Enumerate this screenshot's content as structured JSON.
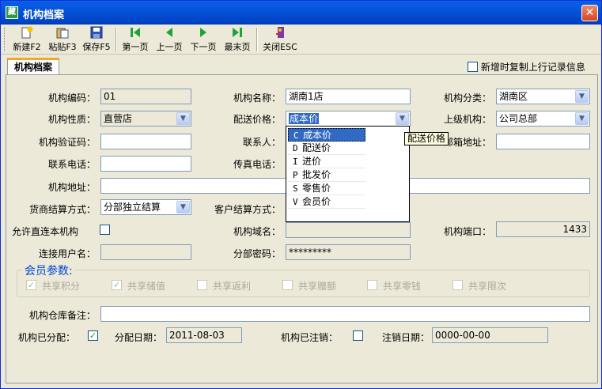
{
  "window": {
    "title": "机构档案",
    "app_icon": "app-logo-icon",
    "close_icon": "close-icon"
  },
  "toolbar": {
    "new": "新建F2",
    "paste": "粘贴F3",
    "save": "保存F5",
    "first": "第一页",
    "prev": "上一页",
    "next": "下一页",
    "last": "最末页",
    "close": "关闭ESC",
    "icons": [
      "new-doc-icon",
      "paste-icon",
      "save-disk-icon",
      "first-page-icon",
      "prev-page-icon",
      "next-page-icon",
      "last-page-icon",
      "exit-door-icon"
    ]
  },
  "tab": {
    "label": "机构档案"
  },
  "copy_prev": {
    "label": "新增时复制上行记录信息",
    "checked": false
  },
  "form": {
    "org_code": {
      "label": "机构编码：",
      "value": "01"
    },
    "org_name": {
      "label": "机构名称：",
      "value": "湖南1店"
    },
    "org_category": {
      "label": "机构分类：",
      "value": "湖南区"
    },
    "org_nature": {
      "label": "机构性质：",
      "value": "直营店"
    },
    "delivery_price": {
      "label": "配送价格：",
      "value": "成本价"
    },
    "parent_org": {
      "label": "上级机构：",
      "value": "公司总部"
    },
    "verify_code": {
      "label": "机构验证码：",
      "value": ""
    },
    "contact": {
      "label": "联系人：",
      "value": ""
    },
    "zip": {
      "label": "邮箱地址：",
      "value": ""
    },
    "phone": {
      "label": "联系电话：",
      "value": ""
    },
    "fax": {
      "label": "传真电话：",
      "value": ""
    },
    "address": {
      "label": "机构地址：",
      "value": ""
    },
    "supplier_settle": {
      "label": "货商结算方式：",
      "value": "分部独立结算"
    },
    "customer_settle": {
      "label": "客户结算方式：",
      "value": ""
    },
    "direct_connect": {
      "label": "允许直连本机构",
      "checked": false
    },
    "domain": {
      "label": "机构域名：",
      "value": ""
    },
    "port": {
      "label": "机构端口：",
      "value": "1433"
    },
    "conn_user": {
      "label": "连接用户名：",
      "value": ""
    },
    "sub_password": {
      "label": "分部密码：",
      "value": "*********"
    },
    "warehouse_note": {
      "label": "机构仓库备注：",
      "value": ""
    },
    "assigned": {
      "label": "机构已分配：",
      "checked": true
    },
    "assign_date": {
      "label": "分配日期：",
      "value": "2011-08-03"
    },
    "cancelled": {
      "label": "机构已注销：",
      "checked": false
    },
    "cancel_date": {
      "label": "注销日期：",
      "value": "0000-00-00"
    }
  },
  "member": {
    "title": "会员参数:",
    "options": [
      {
        "label": "共享积分",
        "checked": true
      },
      {
        "label": "共享储值",
        "checked": true
      },
      {
        "label": "共享返利",
        "checked": false
      },
      {
        "label": "共享赠额",
        "checked": false
      },
      {
        "label": "共享零钱",
        "checked": false
      },
      {
        "label": "共享限次",
        "checked": false
      }
    ]
  },
  "price_dropdown": {
    "items": [
      {
        "code": "C",
        "label": "成本价",
        "selected": true
      },
      {
        "code": "D",
        "label": "配送价",
        "selected": false
      },
      {
        "code": "I",
        "label": "进价",
        "selected": false
      },
      {
        "code": "P",
        "label": "批发价",
        "selected": false
      },
      {
        "code": "S",
        "label": "零售价",
        "selected": false
      },
      {
        "code": "V",
        "label": "会员价",
        "selected": false
      }
    ],
    "tooltip": "配送价格"
  },
  "colors": {
    "titlebar": "#0454d9",
    "accent_tab": "#f5a623",
    "selection": "#316ac5",
    "group_title": "#0046d5"
  }
}
